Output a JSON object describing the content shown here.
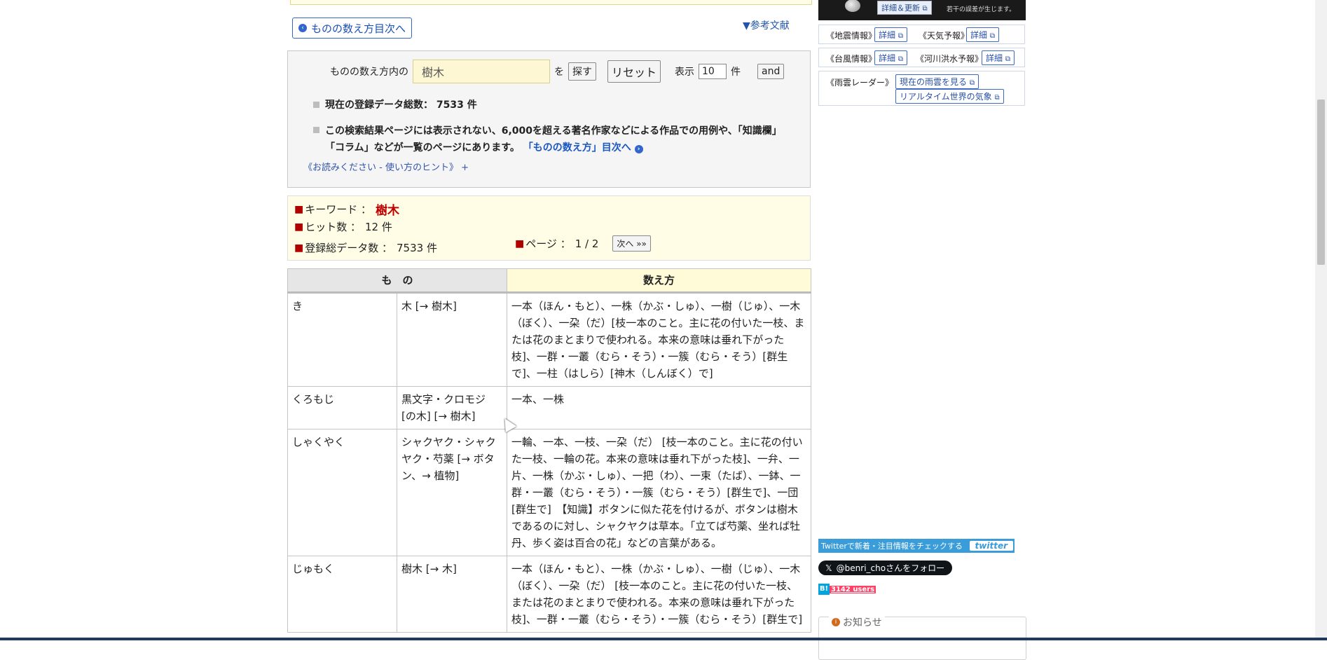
{
  "nav": {
    "toc_button": "ものの数え方目次へ",
    "references_link": "▼参考文献"
  },
  "search": {
    "prefix": "ものの数え方内の",
    "keyword_value": "樹木",
    "particle": "を",
    "search_button": "探す",
    "reset_button": "リセット",
    "display_label": "表示",
    "display_count": "10",
    "count_unit": "件",
    "and_button": "and",
    "total_label": "現在の登録データ総数：",
    "total_value": "7533 件",
    "note_text": "この検索結果ページには表示されない、6,000を超える著名作家などによる作品での用例や、「知識欄」「コラム」などが一覧のページにあります。",
    "note_link": "「ものの数え方」目次へ",
    "hint_link": "《お読みください - 使い方のヒント》 +"
  },
  "result": {
    "keyword_label": "キーワード ：",
    "keyword_value": "樹木",
    "hits_label": "ヒット数 ：",
    "hits_value": "12 件",
    "total_label": "登録総データ数 ：",
    "total_value": "7533 件",
    "page_label": "ページ ：",
    "page_value": "1 / 2",
    "next_button": "次へ »»"
  },
  "table": {
    "header_mono": "も　の",
    "header_count": "数え方",
    "rows": [
      {
        "reading": "き",
        "name": "木 [→ 樹木]",
        "count": "一本（ほん・もと）、一株（かぶ・しゅ）、一樹（じゅ）、一木（ぼく）、一朶（だ）[枝一本のこと。主に花の付いた一枝、または花のまとまりで使われる。本来の意味は垂れ下がった枝]、一群・一叢（むら・そう）・一簇（むら・そう）[群生で]、一柱（はしら）[神木（しんぼく）で]"
      },
      {
        "reading": "くろもじ",
        "name": "黒文字・クロモジ [の木] [→ 樹木]",
        "count": "一本、一株"
      },
      {
        "reading": "しゃくやく",
        "name": "シャクヤク・シャクヤク・芍薬 [→ ボタン、→ 植物]",
        "count": "一輪、一本、一枝、一朶（だ） [枝一本のこと。主に花の付いた一枝、一輪の花。本来の意味は垂れ下がった枝]、一弁、一片、一株（かぶ・しゅ）、一把（わ）、一束（たば）、一鉢、一群・一叢（むら・そう）・一簇（むら・そう）[群生で]、一団 [群生で]　【知識】ボタンに似た花を付けるが、ボタンは樹木であるのに対し、シャクヤクは草本。「立てば芍薬、坐れば牡丹、歩く姿は百合の花」などの言葉がある。"
      },
      {
        "reading": "じゅもく",
        "name": "樹木 [→ 木]",
        "count": "一本（ほん・もと）、一株（かぶ・しゅ）、一樹（じゅ）、一木（ぼく）、一朶（だ） [枝一本のこと。主に花の付いた一枝、または花のまとまりで使われる。本来の意味は垂れ下がった枝]、一群・一叢（むら・そう）・一簇（むら・そう）[群生で]"
      }
    ]
  },
  "sidebar": {
    "moon_update_button": "詳細＆更新",
    "moon_note": "若干の誤差が生じます。",
    "earthquake_label": "《地震情報》",
    "weather_label": "《天気予報》",
    "typhoon_label": "《台風情報》",
    "river_label": "《河川洪水予報》",
    "rain_label": "《雨雲レーダー》",
    "detail_button": "詳細",
    "rain_now_button": "現在の雨雲を見る",
    "realtime_button": "リアルタイム世界の気象",
    "twitter_text": "Twitterで新着・注目情報をチェックする",
    "twitter_logo": "twitter",
    "follow_button": "@benri_choさんをフォロー",
    "hatena_users": "3142 users",
    "notice_title": "お知らせ"
  }
}
